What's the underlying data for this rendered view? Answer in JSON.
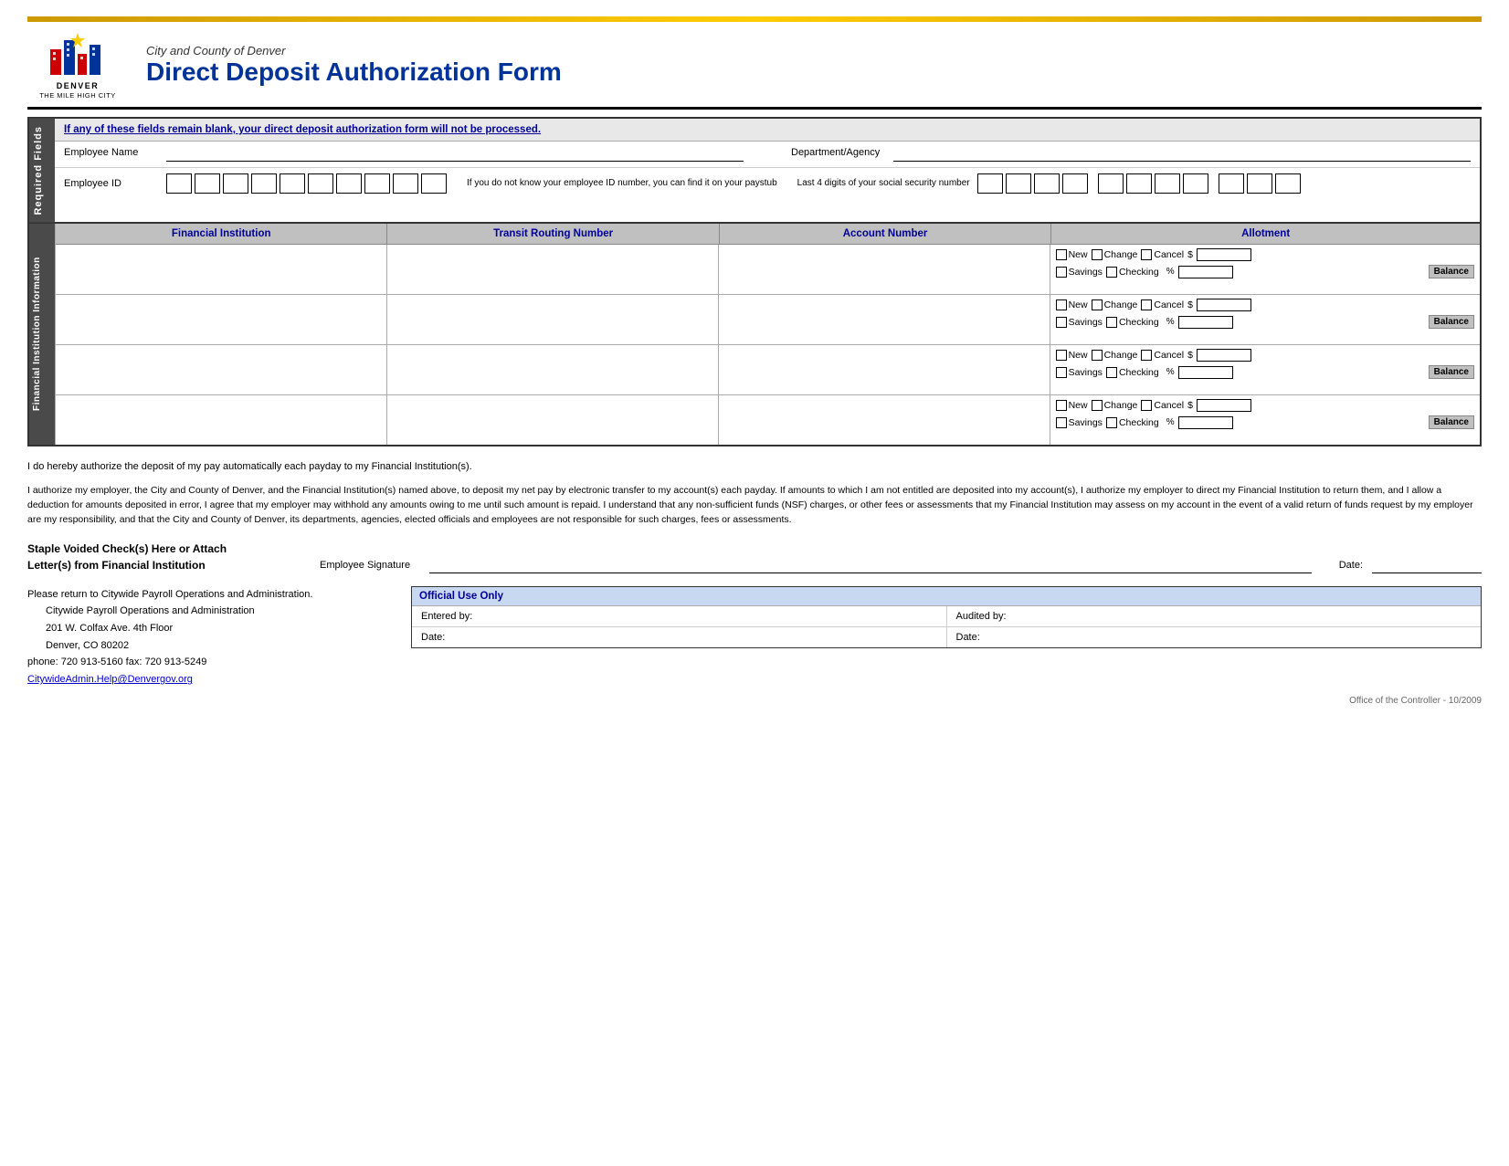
{
  "header": {
    "org_name": "City and County of Denver",
    "form_title": "Direct Deposit Authorization Form",
    "logo_text": "DENVER",
    "logo_subtext": "THE MILE HIGH CITY"
  },
  "warning": {
    "text": "If any of these fields remain blank, your direct deposit authorization form will not be processed."
  },
  "required_fields": {
    "label": "Required Fields",
    "employee_name_label": "Employee Name",
    "department_label": "Department/Agency",
    "employee_id_label": "Employee ID",
    "id_hint": "If you do not know your employee ID number, you can find it on your paystub",
    "social_hint": "Last 4 digits of your social security number"
  },
  "fi_section": {
    "label": "Financial Institution Information",
    "col1": "Financial Institution",
    "col2": "Transit Routing Number",
    "col3": "Account Number",
    "col4": "Allotment"
  },
  "allotment_labels": {
    "new": "New",
    "change": "Change",
    "cancel": "Cancel",
    "savings": "Savings",
    "checking": "Checking",
    "balance": "Balance",
    "dollar": "$",
    "percent": "%"
  },
  "authorization": {
    "line1": "I do hereby authorize the deposit of my pay automatically each payday to my Financial Institution(s).",
    "paragraph": "I authorize my employer, the City and County of Denver, and the Financial Institution(s) named above, to deposit my net pay by electronic transfer to my account(s) each payday. If amounts to which I am not entitled are deposited into my account(s), I authorize my employer to direct my Financial Institution to return them, and I allow a deduction for amounts deposited in error, I agree that my employer may withhold any amounts owing to me until such amount is repaid. I understand that any non-sufficient funds (NSF) charges, or other fees or assessments that my Financial Institution may assess on my account in the event of a valid return of funds request by my employer are my responsibility, and that the City and County of Denver, its departments, agencies, elected officials and employees are not responsible for such charges, fees or assessments."
  },
  "staple": {
    "line1": "Staple Voided Check(s) Here or Attach",
    "line2": "Letter(s) from Financial Institution",
    "signature_label": "Employee Signature",
    "date_label": "Date:"
  },
  "contact": {
    "line1": "Please return to Citywide Payroll Operations and Administration.",
    "line2": "Citywide Payroll Operations and Administration",
    "line3": "201 W. Colfax Ave. 4th Floor",
    "line4": "Denver, CO 80202",
    "line5": "phone: 720 913-5160     fax: 720 913-5249",
    "email": "CitywideAdmin.Help@Denvergov.org"
  },
  "official_use": {
    "title": "Official Use Only",
    "entered_by_label": "Entered by:",
    "audited_by_label": "Audited by:",
    "date_left_label": "Date:",
    "date_right_label": "Date:"
  },
  "footer": {
    "text": "Office of the Controller - 10/2009"
  }
}
